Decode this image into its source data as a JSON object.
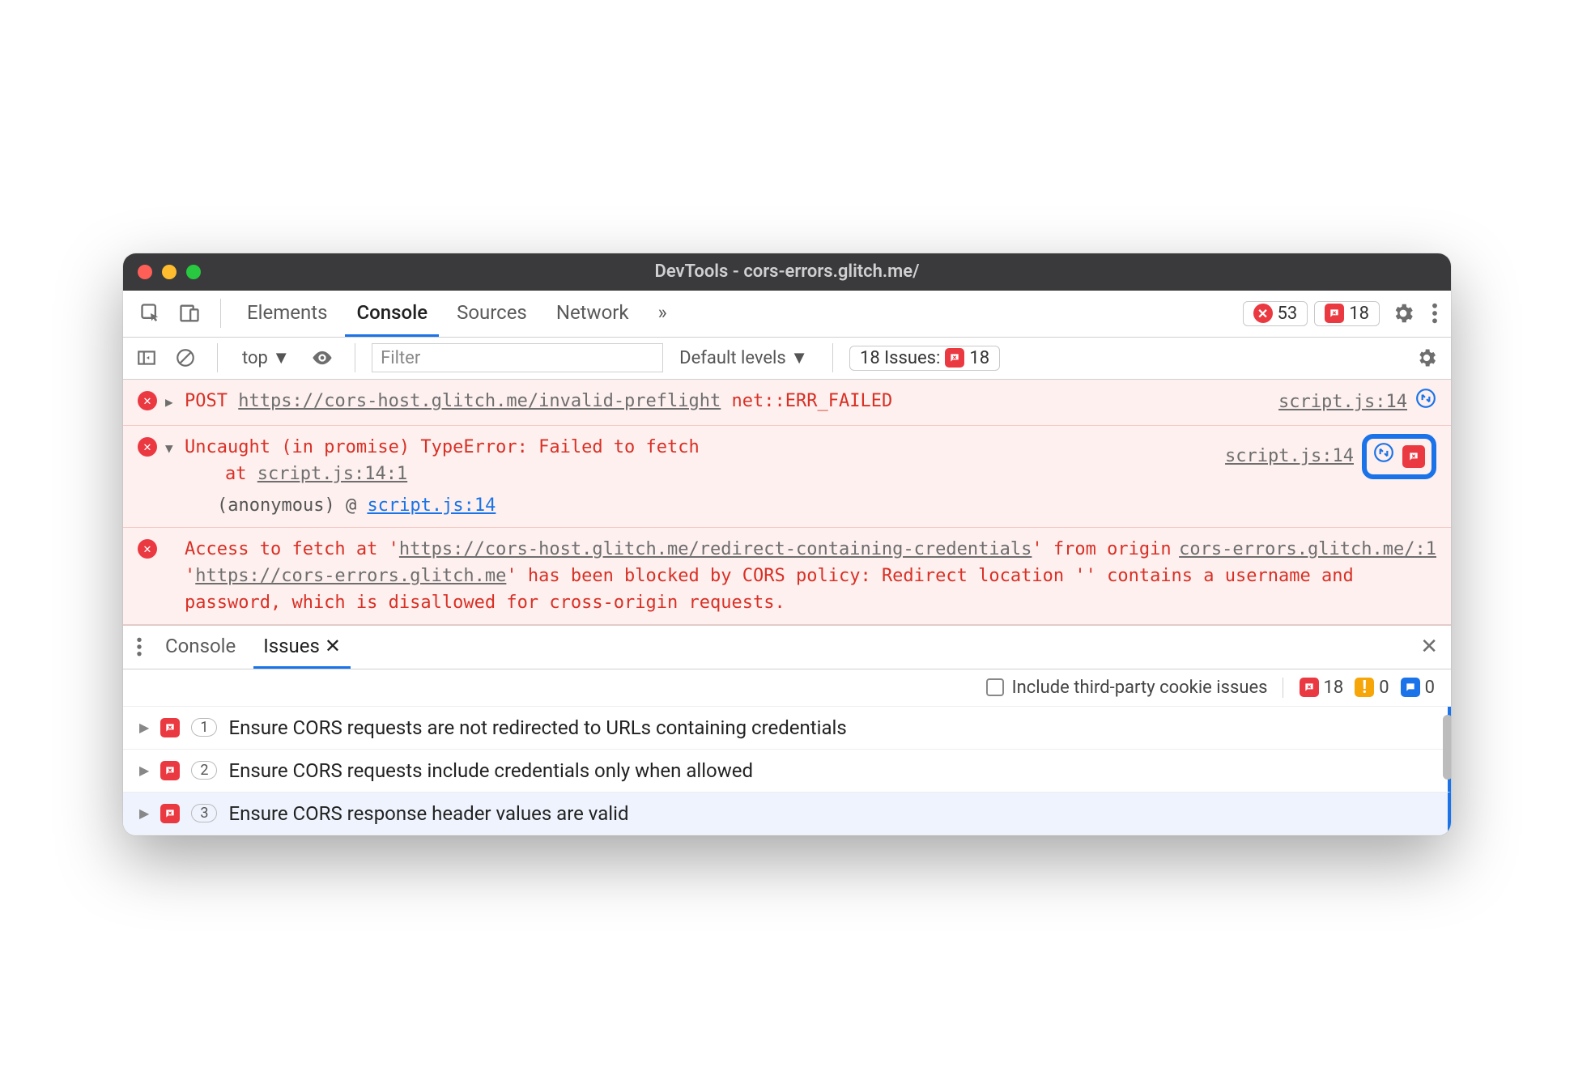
{
  "window": {
    "title": "DevTools - cors-errors.glitch.me/"
  },
  "tabs": {
    "items": [
      "Elements",
      "Console",
      "Sources",
      "Network"
    ],
    "overflow": "»",
    "error_count": "53",
    "issue_count": "18"
  },
  "console_toolbar": {
    "context": "top ▼",
    "filter_placeholder": "Filter",
    "levels": "Default levels ▼",
    "issues_label": "18 Issues:",
    "issues_count": "18"
  },
  "messages": {
    "m1": {
      "method": "POST",
      "url": "https://cors-host.glitch.me/invalid-preflight",
      "err": "net::ERR_FAILED",
      "source": "script.js:14"
    },
    "m2": {
      "text": "Uncaught (in promise) TypeError: Failed to fetch",
      "at_label": "at",
      "at_link": "script.js:14:1",
      "anon": "(anonymous) @",
      "anon_link": "script.js:14",
      "source": "script.js:14"
    },
    "m3": {
      "pre": "Access to fetch at '",
      "url": "https://cors-host.glitch.me/redirect-containing-credentials",
      "mid1": "' from origin '",
      "origin": "https://cors-errors.glitch.me",
      "tail": "' has been blocked by CORS policy: Redirect location '' contains a username and password, which is disallowed for cross-origin requests.",
      "source": "cors-errors.glitch.me/:1"
    }
  },
  "drawer": {
    "tabs": {
      "console": "Console",
      "issues": "Issues"
    },
    "include_label": "Include third-party cookie issues",
    "counts": {
      "err": "18",
      "warn": "0",
      "info": "0"
    },
    "issues": [
      {
        "count": "1",
        "title": "Ensure CORS requests are not redirected to URLs containing credentials"
      },
      {
        "count": "2",
        "title": "Ensure CORS requests include credentials only when allowed"
      },
      {
        "count": "3",
        "title": "Ensure CORS response header values are valid"
      }
    ]
  }
}
